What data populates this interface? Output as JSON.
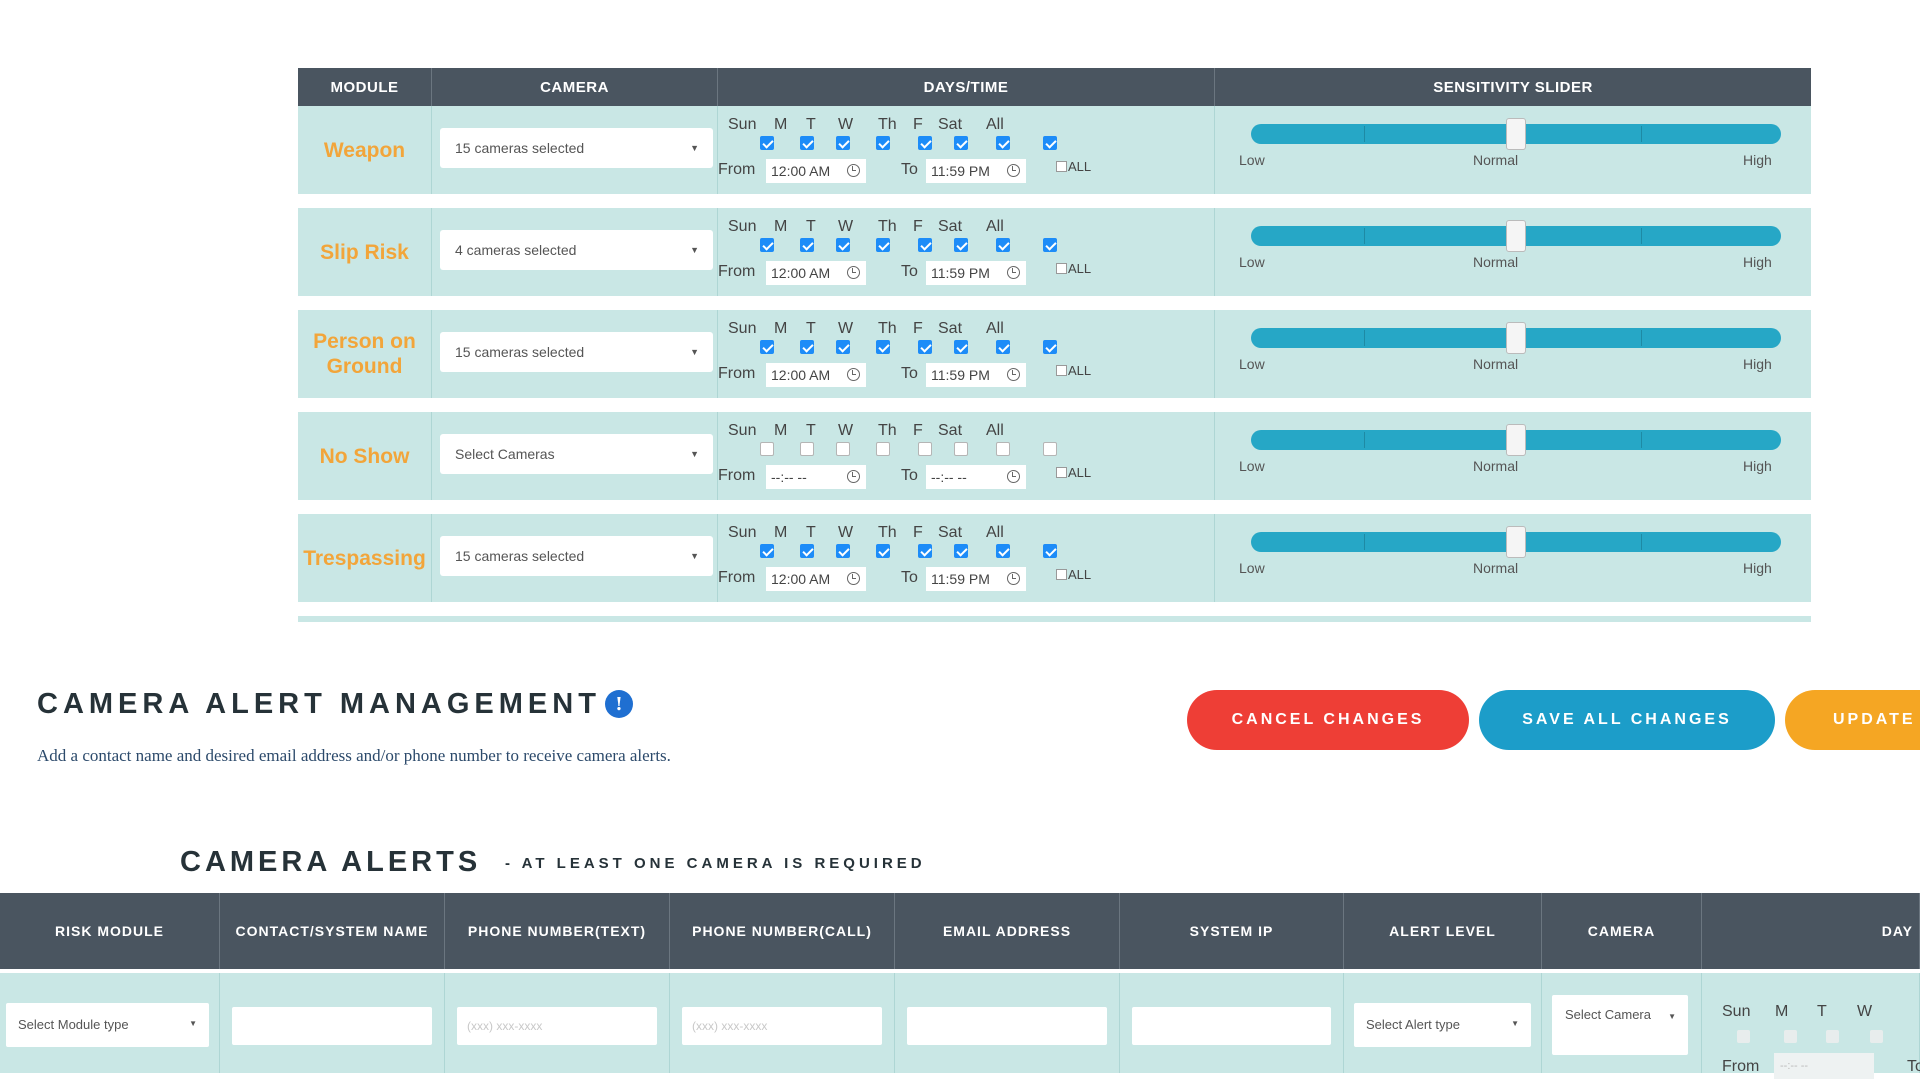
{
  "module_table": {
    "headers": {
      "module": "MODULE",
      "camera": "CAMERA",
      "days_time": "DAYS/TIME",
      "sensitivity": "SENSITIVITY SLIDER"
    },
    "day_labels": [
      "Sun",
      "M",
      "T",
      "W",
      "Th",
      "F",
      "Sat",
      "All"
    ],
    "from_label": "From",
    "to_label": "To",
    "all_label": "ALL",
    "slider_labels": {
      "low": "Low",
      "normal": "Normal",
      "high": "High"
    },
    "rows": [
      {
        "module": "Weapon",
        "camera": "15 cameras selected",
        "days_checked": [
          true,
          true,
          true,
          true,
          true,
          true,
          true,
          true
        ],
        "from": "12:00 AM",
        "to": "11:59 PM",
        "sensitivity": 0.5
      },
      {
        "module": "Slip Risk",
        "camera": "4 cameras selected",
        "days_checked": [
          true,
          true,
          true,
          true,
          true,
          true,
          true,
          true
        ],
        "from": "12:00 AM",
        "to": "11:59 PM",
        "sensitivity": 0.5
      },
      {
        "module": "Person on Ground",
        "camera": "15 cameras selected",
        "days_checked": [
          true,
          true,
          true,
          true,
          true,
          true,
          true,
          true
        ],
        "from": "12:00 AM",
        "to": "11:59 PM",
        "sensitivity": 0.5
      },
      {
        "module": "No Show",
        "camera": "Select Cameras",
        "days_checked": [
          false,
          false,
          false,
          false,
          false,
          false,
          false,
          false
        ],
        "from": "--:-- --",
        "to": "--:-- --",
        "sensitivity": 0.5
      },
      {
        "module": "Trespassing",
        "camera": "15 cameras selected",
        "days_checked": [
          true,
          true,
          true,
          true,
          true,
          true,
          true,
          true
        ],
        "from": "12:00 AM",
        "to": "11:59 PM",
        "sensitivity": 0.5
      }
    ]
  },
  "alert_management": {
    "title": "CAMERA ALERT MANAGEMENT",
    "info_icon": "!",
    "description": "Add a contact name and desired email address and/or phone number to receive camera alerts.",
    "buttons": {
      "cancel": "CANCEL CHANGES",
      "save": "SAVE ALL CHANGES",
      "update": "UPDATE"
    }
  },
  "camera_alerts": {
    "title": "CAMERA ALERTS",
    "subtitle": "- AT LEAST ONE CAMERA IS REQUIRED",
    "headers": [
      "RISK MODULE",
      "CONTACT/SYSTEM NAME",
      "PHONE NUMBER(TEXT)",
      "PHONE NUMBER(CALL)",
      "EMAIL ADDRESS",
      "SYSTEM IP",
      "ALERT LEVEL",
      "CAMERA",
      "DAY"
    ],
    "row": {
      "risk_module": "Select Module type",
      "contact": "",
      "phone_text_placeholder": "(xxx) xxx-xxxx",
      "phone_call_placeholder": "(xxx) xxx-xxxx",
      "email": "",
      "system_ip": "",
      "alert_level": "Select Alert type",
      "camera": "Select Camera",
      "day_labels": [
        "Sun",
        "M",
        "T",
        "W"
      ],
      "from_label": "From",
      "from_value": "--:-- --",
      "to_label": "To"
    }
  },
  "colors": {
    "header_bg": "#4a5560",
    "row_bg": "#c9e7e5",
    "module_text": "#f2a53a",
    "slider": "#26a7c6",
    "cancel": "#ee3e36",
    "save": "#1c9dc9",
    "update": "#f5a623"
  }
}
